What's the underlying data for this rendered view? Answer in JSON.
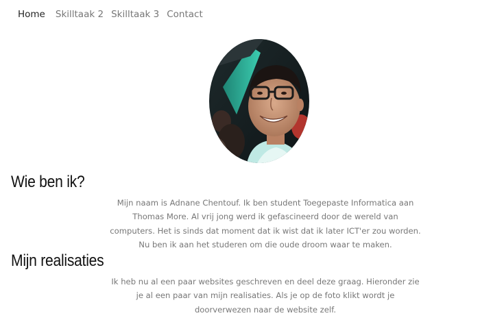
{
  "nav": {
    "items": [
      {
        "label": "Home",
        "active": true
      },
      {
        "label": "Skilltaak 2",
        "active": false
      },
      {
        "label": "Skilltaak 3",
        "active": false
      },
      {
        "label": "Contact",
        "active": false
      }
    ]
  },
  "profile": {
    "photo_icon": "profile-photo"
  },
  "sections": {
    "who": {
      "title": "Wie ben ik?",
      "text": "Mijn naam is Adnane Chentouf. Ik ben student Toegepaste Informatica aan Thomas More. Al vrij jong werd ik gefascineerd door de wereld van computers. Het is sinds dat moment dat ik wist dat ik later ICT'er zou worden. Nu ben ik aan het studeren om die oude droom waar te maken."
    },
    "realisations": {
      "title": "Mijn realisaties",
      "text": "Ik heb nu al een paar websites geschreven en deel deze graag. Hieronder zie je al een paar van mijn realisaties. Als je op de foto klikt wordt je doorverwezen naar de website zelf."
    }
  },
  "colors": {
    "nav_active": "#222222",
    "nav_inactive": "#777777",
    "heading": "#111111",
    "body_text": "#777777",
    "background": "#ffffff"
  }
}
